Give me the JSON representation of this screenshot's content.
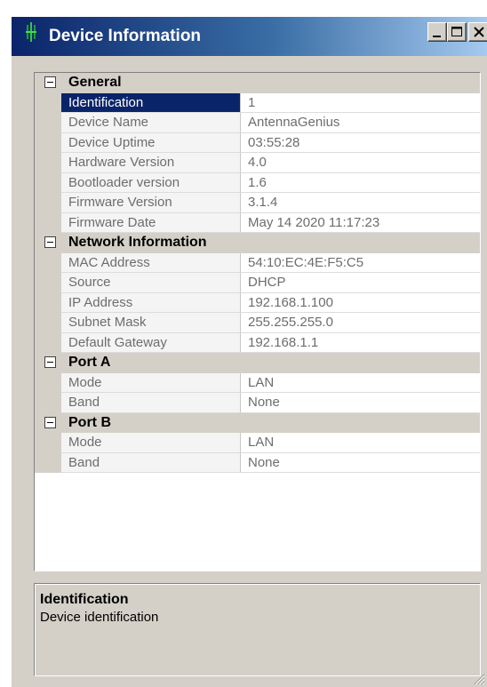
{
  "window": {
    "title": "Device Information",
    "icon": "app-icon",
    "controls": [
      "minimize-icon",
      "maximize-icon",
      "close-icon"
    ]
  },
  "property_grid": {
    "categories": [
      {
        "label": "General",
        "rows": [
          {
            "name": "Identification",
            "value": "1",
            "selected": true
          },
          {
            "name": "Device Name",
            "value": "AntennaGenius"
          },
          {
            "name": "Device Uptime",
            "value": "03:55:28"
          },
          {
            "name": "Hardware Version",
            "value": "4.0"
          },
          {
            "name": "Bootloader version",
            "value": "1.6"
          },
          {
            "name": "Firmware Version",
            "value": "3.1.4"
          },
          {
            "name": "Firmware Date",
            "value": "May 14 2020 11:17:23"
          }
        ]
      },
      {
        "label": "Network Information",
        "rows": [
          {
            "name": "MAC Address",
            "value": "54:10:EC:4E:F5:C5"
          },
          {
            "name": "Source",
            "value": "DHCP"
          },
          {
            "name": "IP Address",
            "value": "192.168.1.100"
          },
          {
            "name": "Subnet Mask",
            "value": "255.255.255.0"
          },
          {
            "name": "Default Gateway",
            "value": "192.168.1.1"
          }
        ]
      },
      {
        "label": "Port A",
        "rows": [
          {
            "name": "Mode",
            "value": "LAN"
          },
          {
            "name": "Band",
            "value": "None"
          }
        ]
      },
      {
        "label": "Port B",
        "rows": [
          {
            "name": "Mode",
            "value": "LAN"
          },
          {
            "name": "Band",
            "value": "None"
          }
        ]
      }
    ]
  },
  "help": {
    "title": "Identification",
    "description": "Device identification"
  },
  "colors": {
    "title_gradient_start": "#0a246a",
    "title_gradient_end": "#a6caf0",
    "selection": "#0a246a",
    "panel": "#d4d0c8"
  }
}
